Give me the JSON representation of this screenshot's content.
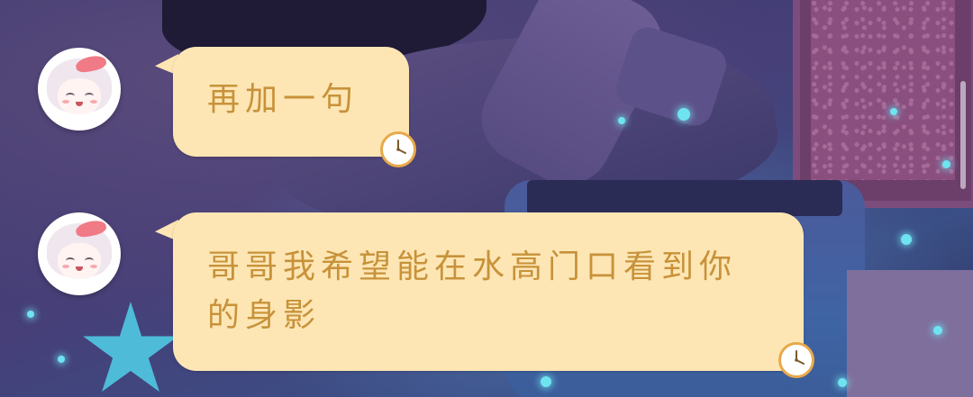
{
  "chat": {
    "messages": [
      {
        "sender": "avatar-girl",
        "text": "再加一句",
        "status_icon": "clock-icon"
      },
      {
        "sender": "avatar-girl",
        "text": "哥哥我希望能在水高门口看到你的身影",
        "status_icon": "clock-icon"
      }
    ]
  },
  "colors": {
    "bubble_bg": "#fde6b4",
    "bubble_text": "#c8923a",
    "clock_ring": "#e8a94b"
  }
}
